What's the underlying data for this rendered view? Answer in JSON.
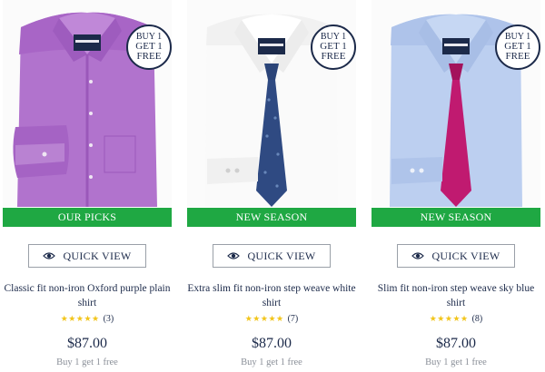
{
  "colors": {
    "ribbon": "#1fa843",
    "text": "#1c2a4a",
    "star": "#f2c51b",
    "muted": "#8a8f98"
  },
  "products": [
    {
      "badge": [
        "BUY 1",
        "GET 1",
        "FREE"
      ],
      "label_logo": "CHARLES TYRWHITT",
      "ribbon": "OUR PICKS",
      "quick_view": "QUICK VIEW",
      "name": "Classic fit non-iron Oxford purple plain shirt",
      "stars": "★★★★★",
      "rating": 5,
      "reviews": "(3)",
      "price": "$87.00",
      "promo": "Buy 1 get 1 free",
      "shirt_color": "#b476cf",
      "tie_color": null
    },
    {
      "badge": [
        "BUY 1",
        "GET 1",
        "FREE"
      ],
      "label_logo": "CHARLES TYRWHITT",
      "ribbon": "NEW SEASON",
      "quick_view": "QUICK VIEW",
      "name": "Extra slim fit non-iron step weave white shirt",
      "stars": "★★★★★",
      "rating": 5,
      "reviews": "(7)",
      "price": "$87.00",
      "promo": "Buy 1 get 1 free",
      "shirt_color": "#f7f7f7",
      "tie_color": "#2f4a82"
    },
    {
      "badge": [
        "BUY 1",
        "GET 1",
        "FREE"
      ],
      "label_logo": "CHARLES TYRWHITT",
      "ribbon": "NEW SEASON",
      "quick_view": "QUICK VIEW",
      "name": "Slim fit non-iron step weave sky blue shirt",
      "stars": "★★★★★",
      "rating": 5,
      "reviews": "(8)",
      "price": "$87.00",
      "promo": "Buy 1 get 1 free",
      "shirt_color": "#b9cdf0",
      "tie_color": "#c01a70"
    }
  ]
}
